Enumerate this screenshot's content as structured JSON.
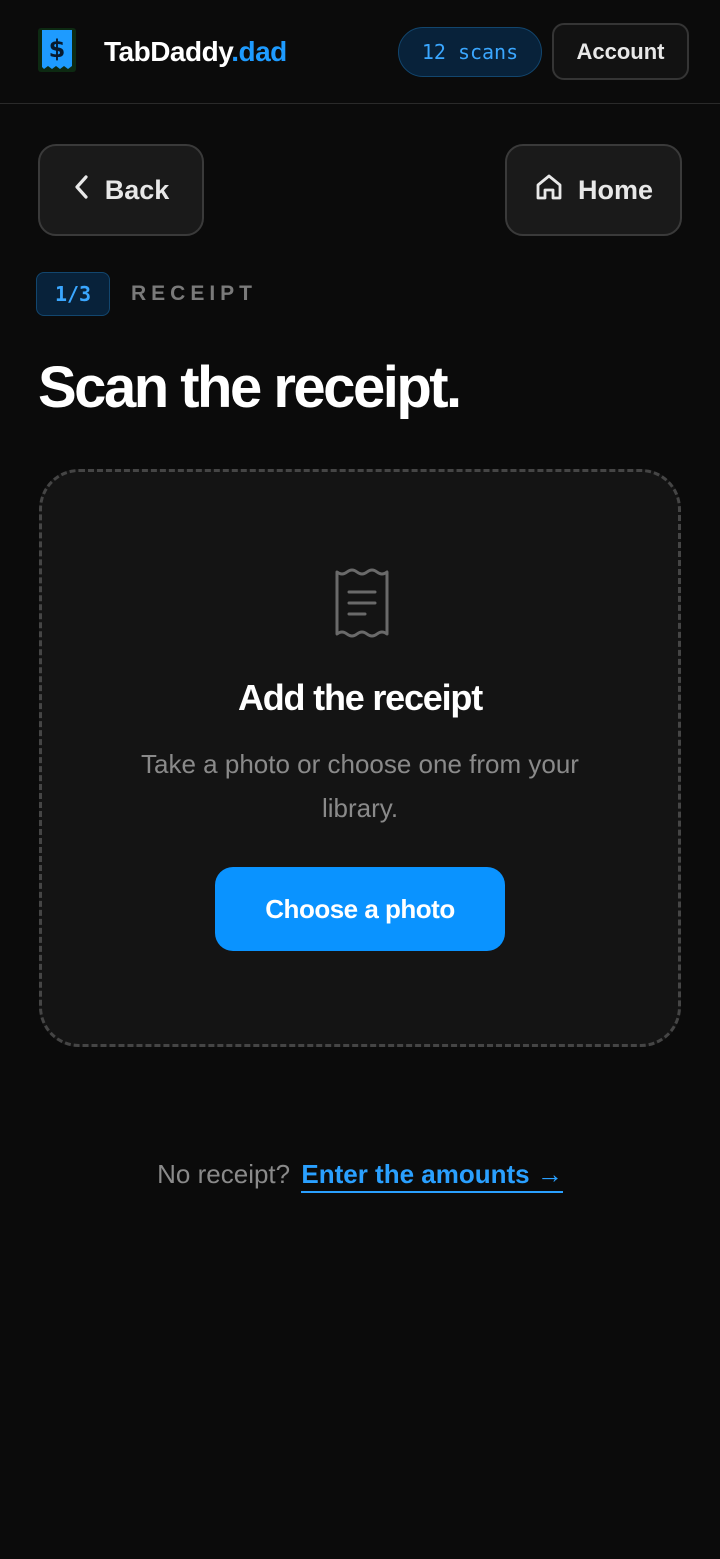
{
  "header": {
    "brand_name": "TabDaddy",
    "brand_tld": ".dad",
    "logo_icon": "dollar-receipt-icon",
    "scans_count": "12",
    "scans_label": "scans",
    "account_label": "Account"
  },
  "nav": {
    "back_label": "Back",
    "back_icon": "chevron-left-icon",
    "home_label": "Home",
    "home_icon": "home-icon"
  },
  "step": {
    "badge": "1/3",
    "label": "RECEIPT"
  },
  "page": {
    "title": "Scan the receipt."
  },
  "dropzone": {
    "icon": "receipt-icon",
    "title": "Add the receipt",
    "description": "Take a photo or choose one from your library.",
    "button_label": "Choose a photo"
  },
  "footer": {
    "prompt": "No receipt?",
    "link_label": "Enter the amounts →"
  },
  "colors": {
    "background": "#0b0b0b",
    "accent": "#0a93ff",
    "link": "#2aa0ff",
    "muted_text": "#8a8a8a"
  }
}
